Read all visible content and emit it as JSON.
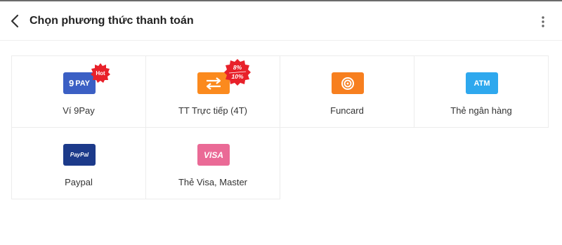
{
  "header": {
    "title": "Chọn phương thức thanh toán",
    "back_icon": "chevron-left-icon",
    "more_icon": "more-vertical-icon"
  },
  "methods": [
    {
      "label": "Ví 9Pay",
      "icon": "9pay-icon",
      "icon_text": "PAY",
      "icon_prefix": "9",
      "color": "#3b5fc4",
      "badge": "Hot"
    },
    {
      "label": "TT Trực tiếp (4T)",
      "icon": "transfer-icon",
      "color": "#fb8a1e",
      "badge_top": "8%",
      "badge_bottom": "10%"
    },
    {
      "label": "Funcard",
      "icon": "funcard-icon",
      "color": "#f77f1f"
    },
    {
      "label": "Thẻ ngân hàng",
      "icon": "atm-icon",
      "icon_text": "ATM",
      "color": "#2ea8ee"
    },
    {
      "label": "Paypal",
      "icon": "paypal-icon",
      "icon_text": "PayPal",
      "color": "#1c3a8a"
    },
    {
      "label": "Thẻ Visa, Master",
      "icon": "visa-icon",
      "icon_text": "VISA",
      "color": "#ea6a96"
    }
  ],
  "colors": {
    "badge_red": "#e8212a",
    "border": "#ececec"
  }
}
